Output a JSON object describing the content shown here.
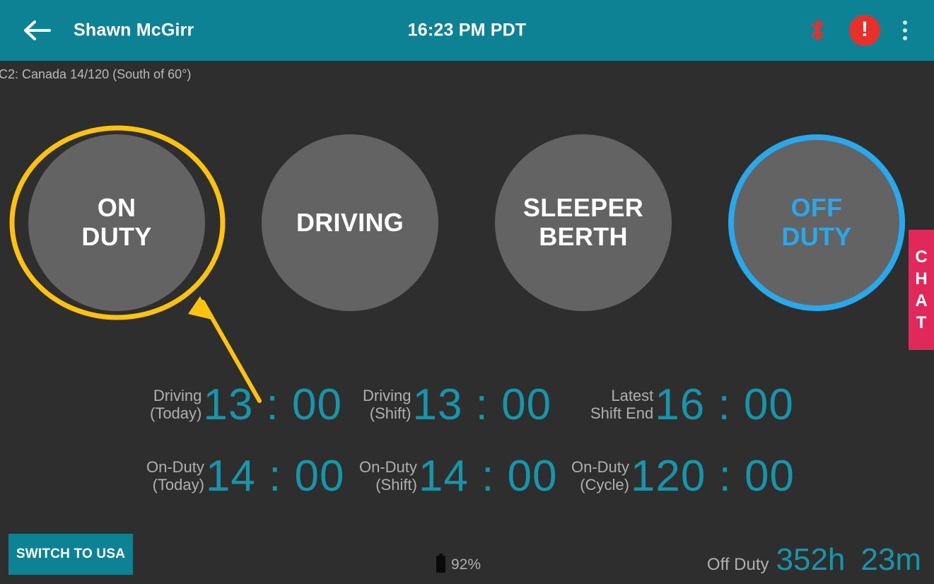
{
  "header": {
    "back_icon": "back-arrow-icon",
    "driver_name": "Shawn McGirr",
    "clock": "16:23 PM PDT",
    "bluetooth_icon": "bluetooth-icon",
    "bluetooth_color": "#e8302a",
    "alert_label": "!",
    "alert_color": "#e8302a",
    "overflow_icon": "overflow-menu-icon",
    "background_color": "#0e8295"
  },
  "ruleset": {
    "text": "C2: Canada 14/120 (South of 60°)"
  },
  "duty_statuses": [
    {
      "label": "ON\nDUTY",
      "line1": "ON",
      "line2": "DUTY",
      "selected": false
    },
    {
      "label": "DRIVING",
      "line1": "DRIVING",
      "line2": "",
      "selected": false
    },
    {
      "label": "SLEEPER BERTH",
      "line1": "SLEEPER",
      "line2": "BERTH",
      "selected": false
    },
    {
      "label": "OFF DUTY",
      "line1": "OFF",
      "line2": "DUTY",
      "selected": true
    }
  ],
  "selected_color": "#29a8ec",
  "chat_tab": {
    "letters": [
      "C",
      "H",
      "A",
      "T"
    ],
    "label": "CHAT",
    "color": "#e0285a"
  },
  "timers": {
    "row1": [
      {
        "label_line1": "Driving",
        "label_line2": "(Today)",
        "value": "13 : 00"
      },
      {
        "label_line1": "Driving",
        "label_line2": "(Shift)",
        "value": "13 : 00"
      },
      {
        "label_line1": "Latest",
        "label_line2": "Shift End",
        "value": "16 : 00"
      }
    ],
    "row2": [
      {
        "label_line1": "On-Duty",
        "label_line2": "(Today)",
        "value": "14 : 00"
      },
      {
        "label_line1": "On-Duty",
        "label_line2": "(Shift)",
        "value": "14 : 00"
      },
      {
        "label_line1": "On-Duty",
        "label_line2": "(Cycle)",
        "value": "120 : 00"
      }
    ]
  },
  "footer": {
    "switch_button": "SWITCH TO USA",
    "battery_percent": "92%",
    "battery_icon": "battery-icon",
    "offduty_label": "Off Duty",
    "offduty_hours": "352h",
    "offduty_minutes": "23m"
  },
  "annotation": {
    "highlight_color": "#ffc20e",
    "kind": "circle-highlight-with-arrow",
    "target": "on-duty-button"
  }
}
